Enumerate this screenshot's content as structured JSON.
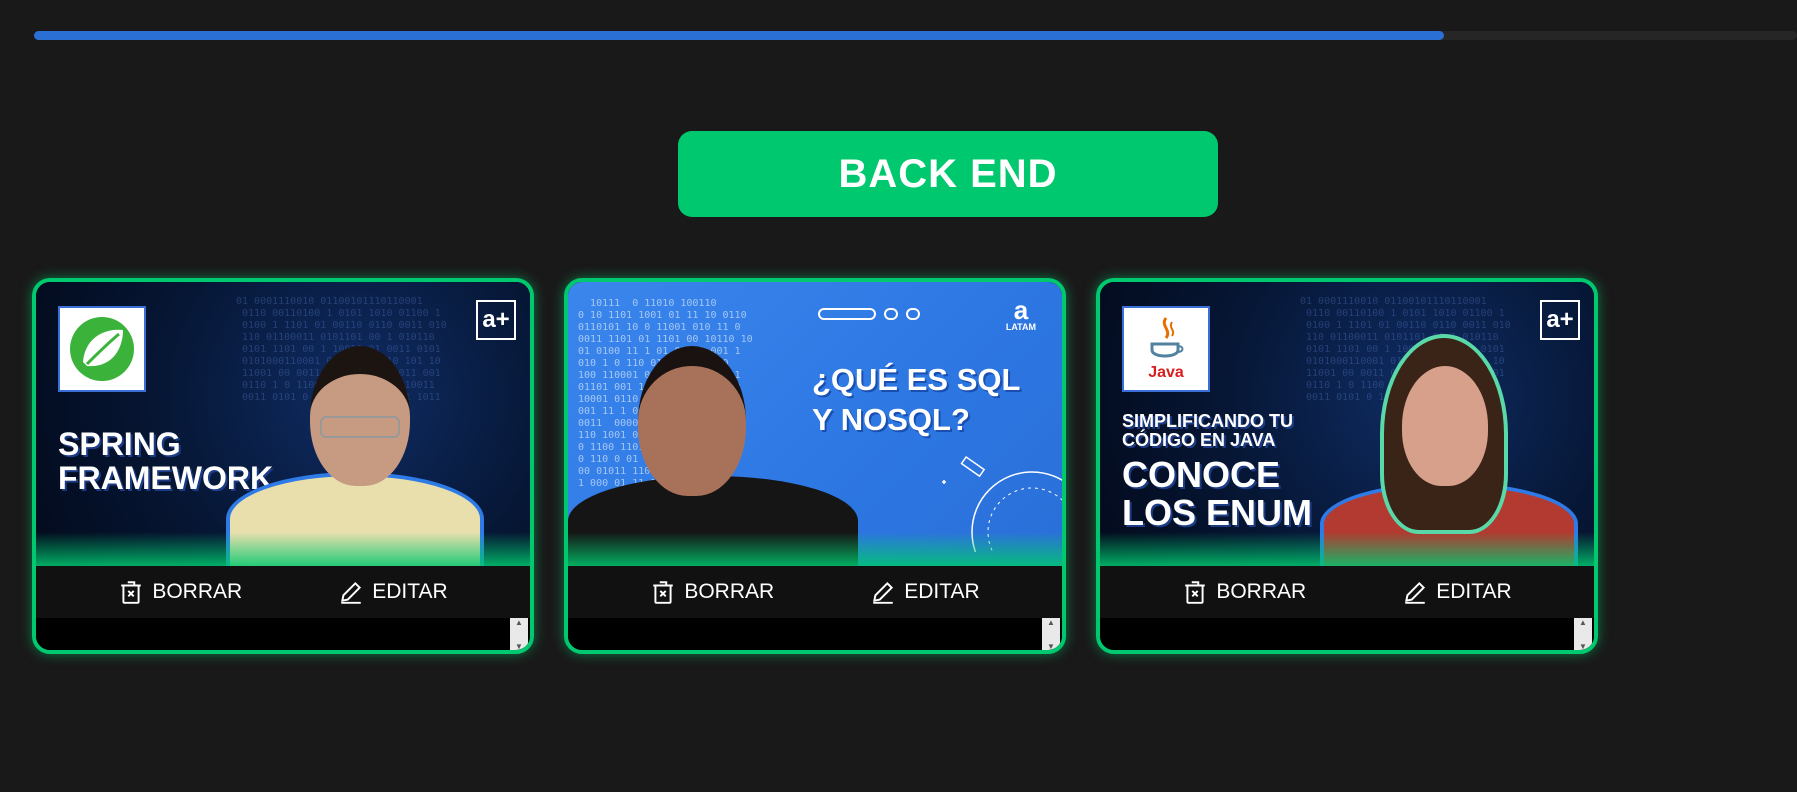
{
  "progress": {
    "fill_percent": 80
  },
  "category": {
    "title": "BACK END"
  },
  "colors": {
    "accent": "#00c86f",
    "progress": "#2a6fd4",
    "background": "#191919"
  },
  "cards": [
    {
      "thumb_lines": [
        "SPRING",
        "FRAMEWORK"
      ],
      "badge": "a+",
      "logo_icon": "spring-leaf-icon",
      "delete_label": "BORRAR",
      "edit_label": "EDITAR"
    },
    {
      "thumb_lines": [
        "¿QUÉ ES SQL",
        "Y NOSQL?"
      ],
      "brand_mark": "a",
      "brand_name": "LATAM",
      "delete_label": "BORRAR",
      "edit_label": "EDITAR"
    },
    {
      "thumb_sub_lines": [
        "SIMPLIFICANDO TU",
        "CÓDIGO EN JAVA"
      ],
      "thumb_lines": [
        "CONOCE",
        "LOS ENUM"
      ],
      "badge": "a+",
      "logo_text": "Java",
      "logo_icon": "java-cup-icon",
      "delete_label": "BORRAR",
      "edit_label": "EDITAR"
    }
  ]
}
